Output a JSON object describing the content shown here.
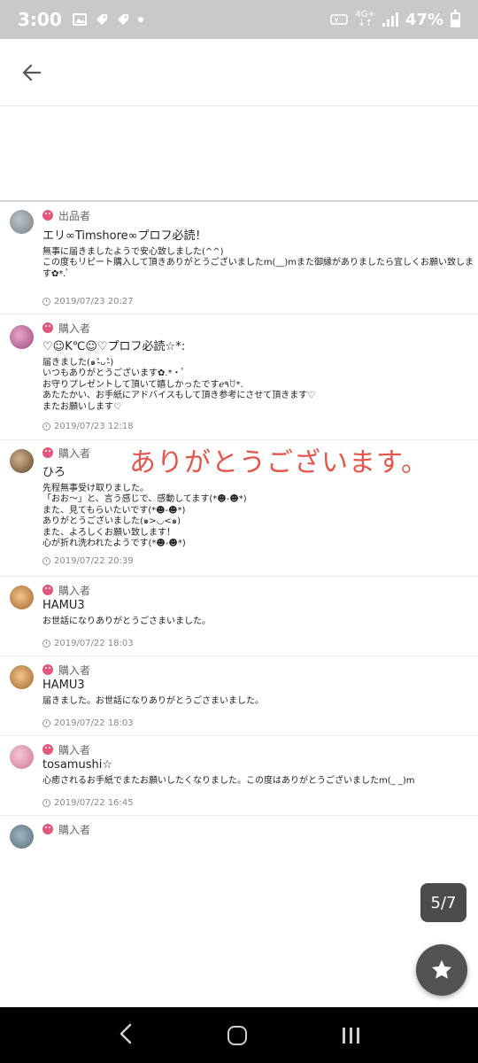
{
  "status_bar": {
    "time": "3:00",
    "network_top": "4G+",
    "network_bottom": "↓↑",
    "battery_pct": "47%",
    "battery_level": 0.47
  },
  "header": {
    "back_icon": "arrow-left-icon"
  },
  "reviews": [
    {
      "role": "出品者",
      "name": "エリ∞Timshore∞プロフ必読！",
      "comment": "無事に届きましたようで安心致しました(^^)\nこの度もリピート購入して頂きありがとうございましたm(__)mまた御縁がありましたら宜しくお願い致します✿*.ﾟ",
      "date": "2019/07/23 20:27"
    },
    {
      "role": "購入者",
      "name": "♡☺K℃☺♡プロフ必読☆*:",
      "comment": "届きました(๑˃̵ᴗ˂̵)\nいつもありがとうございます✿.*・ﾟ\nお守りプレゼントして頂いて嬉しかったですℯ٩ꇴ*.\nあたたかい、お手紙にアドバイスもして頂き参考にさせて頂きます♡\nまたお願いします♡",
      "date": "2019/07/23 12:18"
    },
    {
      "role": "購入者",
      "name": "ひろ",
      "comment": "先程無事受け取りました。\n「おお～」と、言う感じで、感動してます(*☻-☻*)\nまた、見てもらいたいです(*☻-☻*)\nありがとうございました(๑>◡<๑)\nまた、よろしくお願い致します！\n心が折れ洗われたようです(*☻-☻*)",
      "date": "2019/07/22 20:39"
    },
    {
      "role": "購入者",
      "name": "HAMU3",
      "comment": "お世話になりありがとうごさまいました。",
      "date": "2019/07/22 18:03"
    },
    {
      "role": "購入者",
      "name": "HAMU3",
      "comment": "届きました。お世話になりありがとうごさまいました。",
      "date": "2019/07/22 18:03"
    },
    {
      "role": "購入者",
      "name": "tosamushi☆",
      "comment": "心癒されるお手紙でまたお願いしたくなりました。この度はありがとうございましたm(_ _)m",
      "date": "2019/07/22 16:45"
    },
    {
      "role": "購入者",
      "name": "",
      "comment": "",
      "date": ""
    }
  ],
  "overlay_text": "ありがとうございます。",
  "page_counter": "5/7",
  "fab_icon": "star-icon",
  "nav": {
    "back_icon": "nav-back-icon",
    "home_icon": "nav-home-icon",
    "recents_icon": "nav-recents-icon"
  }
}
